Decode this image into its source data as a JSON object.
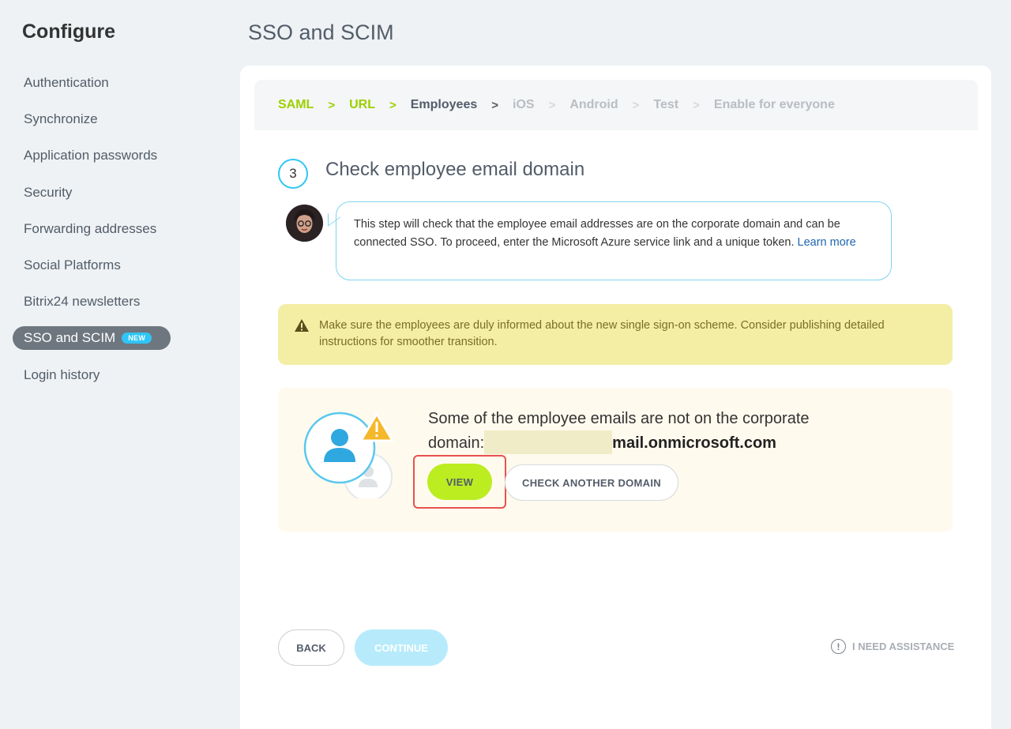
{
  "sidebar": {
    "title": "Configure",
    "items": [
      {
        "label": "Authentication"
      },
      {
        "label": "Synchronize"
      },
      {
        "label": "Application passwords"
      },
      {
        "label": "Security"
      },
      {
        "label": "Forwarding addresses"
      },
      {
        "label": "Social Platforms"
      },
      {
        "label": "Bitrix24 newsletters"
      },
      {
        "label": "SSO and SCIM",
        "badge": "NEW",
        "active": true
      },
      {
        "label": "Login history"
      }
    ]
  },
  "page": {
    "title": "SSO and SCIM"
  },
  "stepper": {
    "steps": [
      {
        "label": "SAML",
        "state": "done"
      },
      {
        "label": "URL",
        "state": "done"
      },
      {
        "label": "Employees",
        "state": "current"
      },
      {
        "label": "iOS",
        "state": "pending"
      },
      {
        "label": "Android",
        "state": "pending"
      },
      {
        "label": "Test",
        "state": "pending"
      },
      {
        "label": "Enable for everyone",
        "state": "pending"
      }
    ],
    "separator": ">"
  },
  "step": {
    "number": "3",
    "heading": "Check employee email domain"
  },
  "bubble": {
    "text": "This step will check that the employee email addresses are on the corporate domain and can be connected SSO. To proceed, enter the Microsoft Azure service link and a unique token.",
    "link": "Learn more"
  },
  "warning": {
    "text": "Make sure the employees are duly informed about the new single sign-on scheme. Consider publishing detailed instructions for smoother transition.",
    "icon": "warning-triangle-icon"
  },
  "result": {
    "text_line1": "Some of the employee emails are not on the corporate",
    "text_prefix": "domain:",
    "domain_suffix": "mail.onmicrosoft.com",
    "view_label": "VIEW",
    "check_label": "CHECK ANOTHER DOMAIN"
  },
  "footer": {
    "back_label": "BACK",
    "continue_label": "CONTINUE",
    "assist_label": "I NEED ASSISTANCE"
  },
  "colors": {
    "accent_green": "#9dcf00",
    "accent_blue": "#2fc6f6",
    "highlight_red": "#e8524f"
  }
}
